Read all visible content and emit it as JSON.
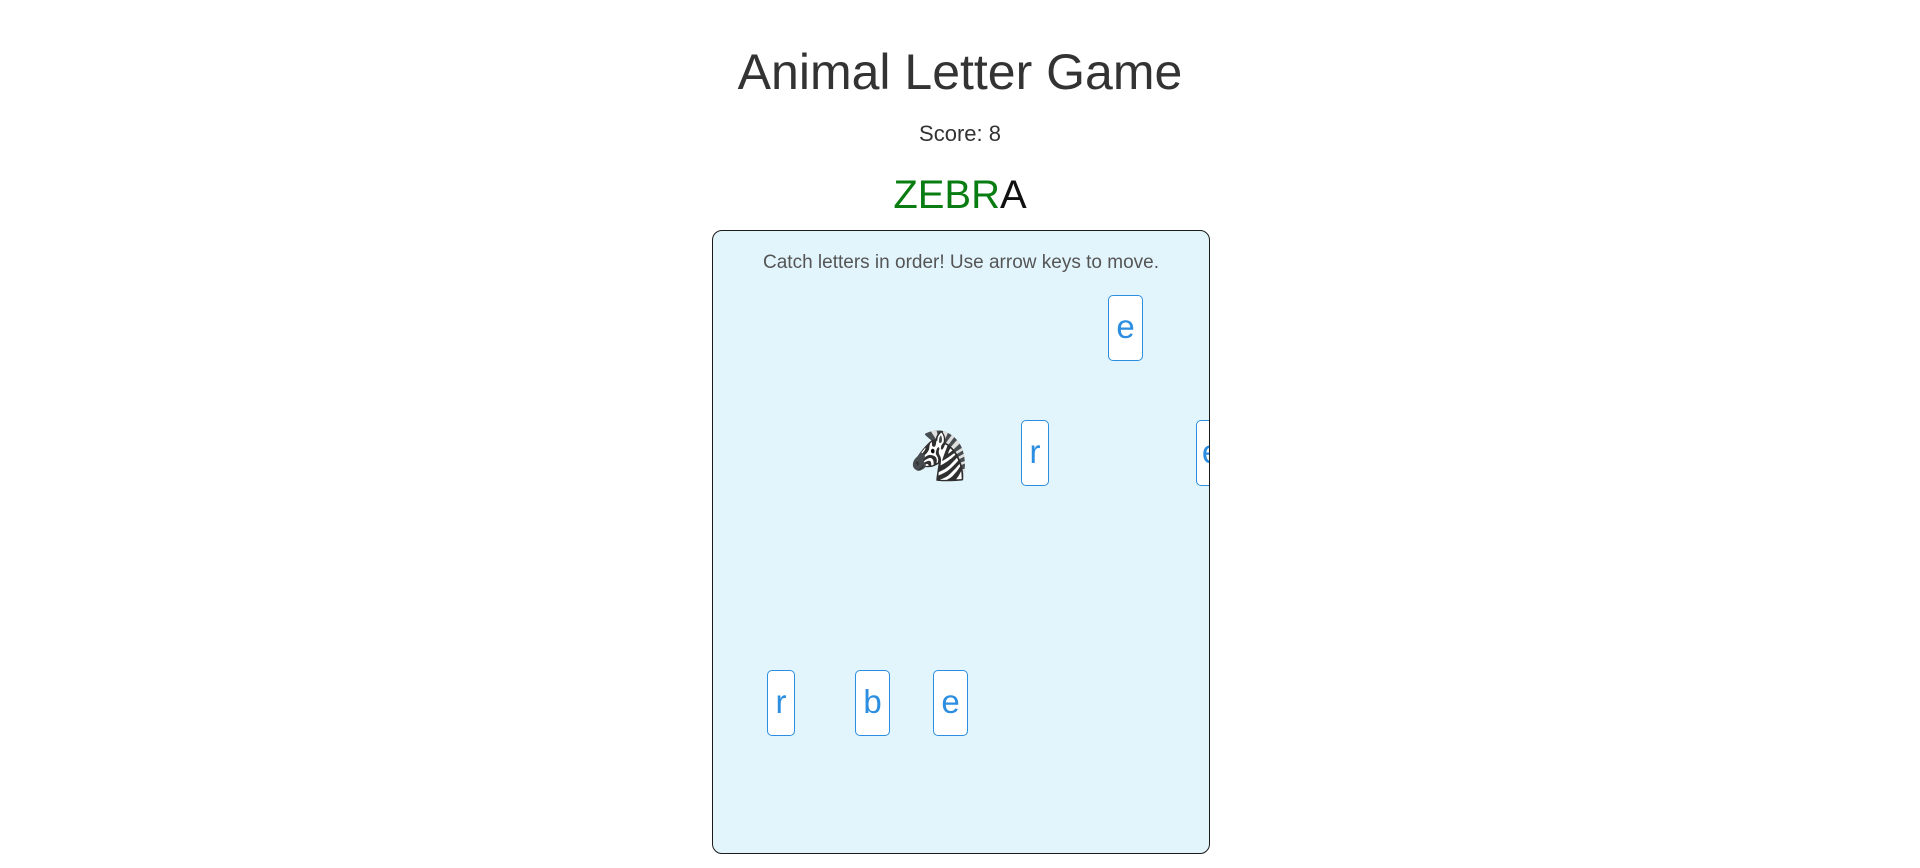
{
  "title": "Animal Letter Game",
  "score_text": "Score: 8",
  "target_word": {
    "caught": "ZEBR",
    "remaining": "A",
    "caught_color": "#0a7d12"
  },
  "instructions": "Catch letters in order! Use arrow keys to move.",
  "player": {
    "icon": "zebra-icon",
    "glyph": "🦓"
  },
  "falling_letters": [
    {
      "letter": "e"
    },
    {
      "letter": "r"
    },
    {
      "letter": "e"
    },
    {
      "letter": "r"
    },
    {
      "letter": "b"
    },
    {
      "letter": "e"
    }
  ],
  "colors": {
    "board_bg": "#e3f5fc",
    "tile_border": "#2c8ee0"
  }
}
